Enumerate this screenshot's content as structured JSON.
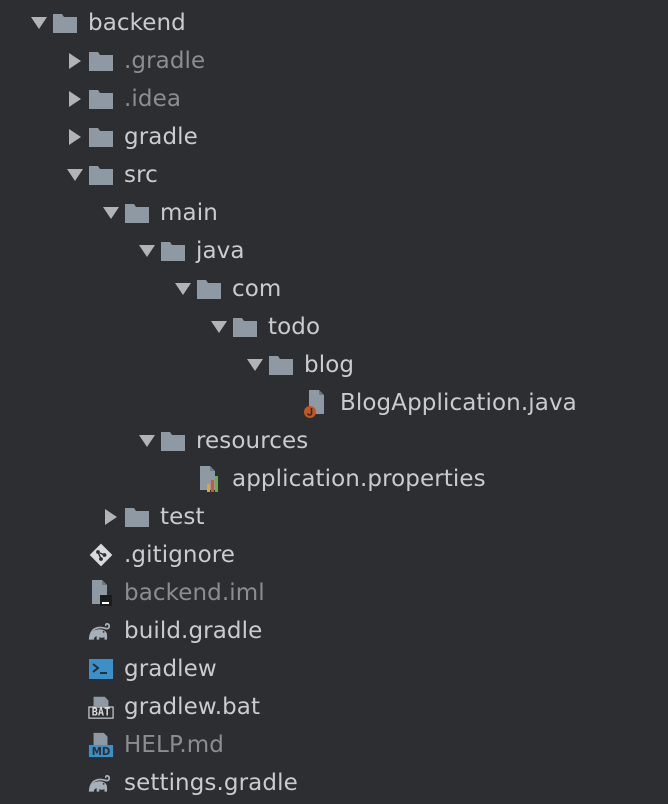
{
  "colors": {
    "background": "#2c2e31",
    "text": "#c8ccd1",
    "text_dim": "#8a8e93",
    "folder": "#8e99a4",
    "arrow": "#b0b3b8"
  },
  "tree": [
    {
      "label": "backend",
      "depth": 0,
      "arrow": "expanded",
      "icon": "folder-icon",
      "dim": false
    },
    {
      "label": ".gradle",
      "depth": 1,
      "arrow": "collapsed",
      "icon": "folder-icon",
      "dim": true
    },
    {
      "label": ".idea",
      "depth": 1,
      "arrow": "collapsed",
      "icon": "folder-icon",
      "dim": true
    },
    {
      "label": "gradle",
      "depth": 1,
      "arrow": "collapsed",
      "icon": "folder-icon",
      "dim": false
    },
    {
      "label": "src",
      "depth": 1,
      "arrow": "expanded",
      "icon": "folder-icon",
      "dim": false
    },
    {
      "label": "main",
      "depth": 2,
      "arrow": "expanded",
      "icon": "folder-icon",
      "dim": false
    },
    {
      "label": "java",
      "depth": 3,
      "arrow": "expanded",
      "icon": "folder-icon",
      "dim": false
    },
    {
      "label": "com",
      "depth": 4,
      "arrow": "expanded",
      "icon": "folder-icon",
      "dim": false
    },
    {
      "label": "todo",
      "depth": 5,
      "arrow": "expanded",
      "icon": "folder-icon",
      "dim": false
    },
    {
      "label": "blog",
      "depth": 6,
      "arrow": "expanded",
      "icon": "folder-icon",
      "dim": false
    },
    {
      "label": "BlogApplication.java",
      "depth": 7,
      "arrow": "none",
      "icon": "java-file-icon",
      "dim": false
    },
    {
      "label": "resources",
      "depth": 3,
      "arrow": "expanded",
      "icon": "folder-icon",
      "dim": false
    },
    {
      "label": "application.properties",
      "depth": 4,
      "arrow": "none",
      "icon": "properties-file-icon",
      "dim": false
    },
    {
      "label": "test",
      "depth": 2,
      "arrow": "collapsed",
      "icon": "folder-icon",
      "dim": false
    },
    {
      "label": ".gitignore",
      "depth": 1,
      "arrow": "none",
      "icon": "git-icon",
      "dim": false
    },
    {
      "label": "backend.iml",
      "depth": 1,
      "arrow": "none",
      "icon": "iml-file-icon",
      "dim": true
    },
    {
      "label": "build.gradle",
      "depth": 1,
      "arrow": "none",
      "icon": "gradle-elephant-icon",
      "dim": false
    },
    {
      "label": "gradlew",
      "depth": 1,
      "arrow": "none",
      "icon": "shell-script-icon",
      "dim": false
    },
    {
      "label": "gradlew.bat",
      "depth": 1,
      "arrow": "none",
      "icon": "bat-file-icon",
      "dim": false
    },
    {
      "label": "HELP.md",
      "depth": 1,
      "arrow": "none",
      "icon": "markdown-file-icon",
      "dim": true
    },
    {
      "label": "settings.gradle",
      "depth": 1,
      "arrow": "none",
      "icon": "gradle-elephant-icon",
      "dim": false
    }
  ]
}
